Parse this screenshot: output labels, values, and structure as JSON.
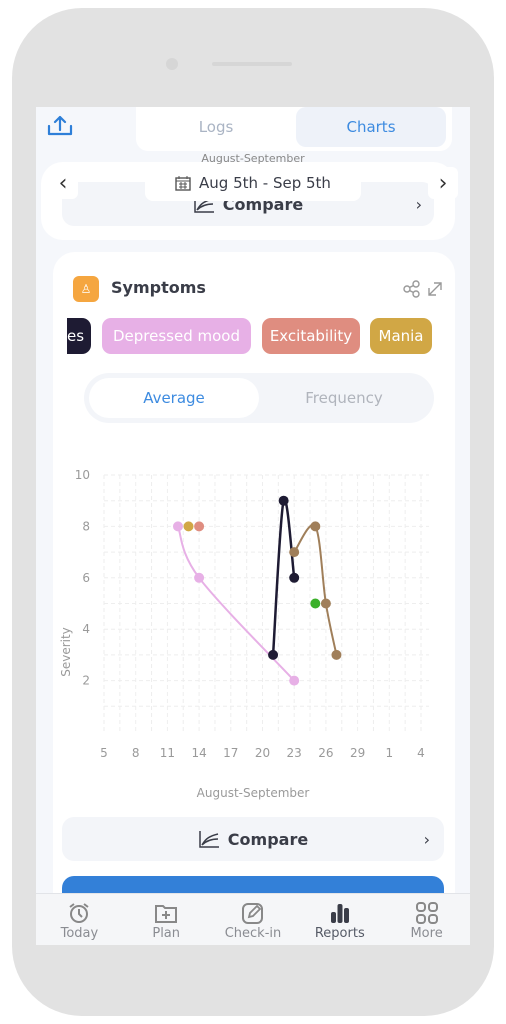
{
  "tabs": {
    "logs": "Logs",
    "charts": "Charts",
    "active": "Charts"
  },
  "date_nav": {
    "month_label": "August-September",
    "range": "Aug 5th - Sep 5th"
  },
  "top_compare": "Compare",
  "symptoms": {
    "title": "Symptoms",
    "chips": [
      {
        "label": "es",
        "color": "#1e1b33"
      },
      {
        "label": "Depressed mood",
        "color": "#e7b0e6"
      },
      {
        "label": "Excitability",
        "color": "#df8d80"
      },
      {
        "label": "Mania",
        "color": "#d1a745"
      }
    ],
    "toggle": {
      "average": "Average",
      "frequency": "Frequency",
      "active": "Average"
    },
    "compare": "Compare"
  },
  "chart_data": {
    "type": "line",
    "xlabel": "August-September",
    "ylabel": "Severity",
    "x_ticks": [
      "5",
      "8",
      "11",
      "14",
      "17",
      "20",
      "23",
      "26",
      "29",
      "1",
      "4"
    ],
    "x_range": [
      "Aug 5",
      "Sep 4"
    ],
    "ylim": [
      0,
      10
    ],
    "y_ticks": [
      2,
      4,
      6,
      8,
      10
    ],
    "grid": true,
    "series": [
      {
        "color": "#e7b0e6",
        "points": [
          [
            "Aug 12",
            8
          ],
          [
            "Aug 14",
            6
          ],
          [
            "Aug 23",
            2
          ]
        ]
      },
      {
        "color": "#d1a745",
        "points": [
          [
            "Aug 13",
            8
          ]
        ]
      },
      {
        "color": "#df8d80",
        "points": [
          [
            "Aug 14",
            8
          ]
        ]
      },
      {
        "color": "#1e1b33",
        "points": [
          [
            "Aug 21",
            3
          ],
          [
            "Aug 22",
            9
          ],
          [
            "Aug 23",
            6
          ]
        ]
      },
      {
        "color": "#a07f5a",
        "points": [
          [
            "Aug 23",
            7
          ],
          [
            "Aug 25",
            8
          ],
          [
            "Aug 26",
            5
          ],
          [
            "Aug 27",
            3
          ]
        ]
      },
      {
        "color": "#3bb02a",
        "points": [
          [
            "Aug 25",
            5
          ]
        ]
      }
    ]
  },
  "bottom_nav": [
    {
      "label": "Today",
      "icon": "alarm-clock-icon"
    },
    {
      "label": "Plan",
      "icon": "folder-plus-icon"
    },
    {
      "label": "Check-in",
      "icon": "edit-icon"
    },
    {
      "label": "Reports",
      "icon": "bar-chart-icon",
      "active": true
    },
    {
      "label": "More",
      "icon": "grid-icon"
    }
  ]
}
